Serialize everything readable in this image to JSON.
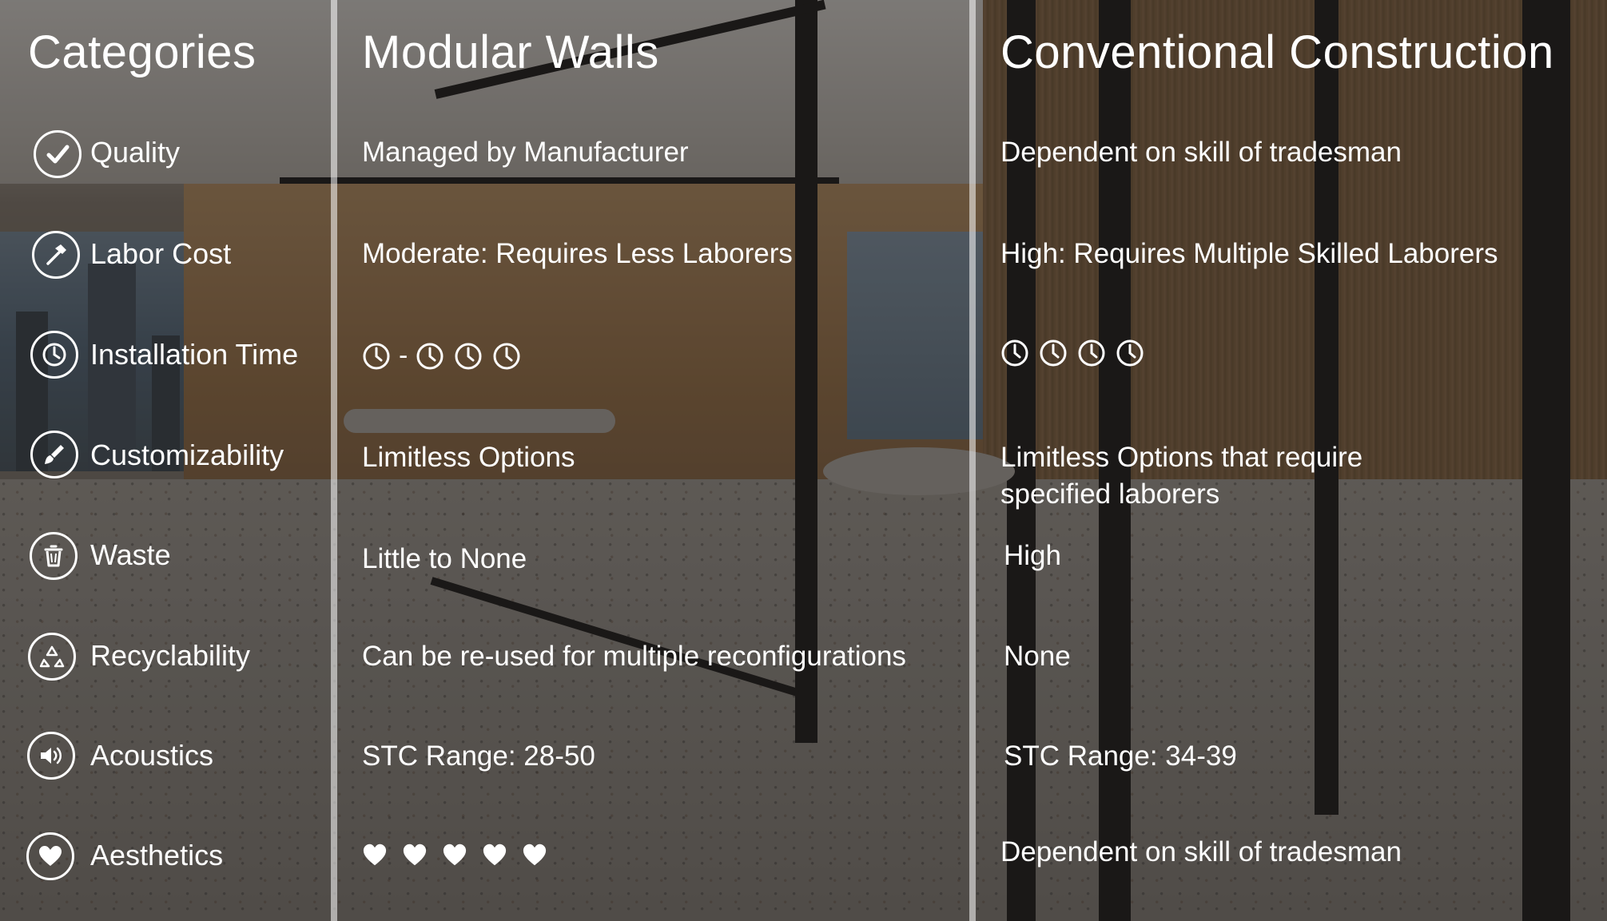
{
  "headers": {
    "categories": "Categories",
    "modular": "Modular Walls",
    "conventional": "Conventional Construction"
  },
  "rows": [
    {
      "icon": "checkmark-icon",
      "label": "Quality",
      "modular": "Managed by Manufacturer",
      "conventional": "Dependent on skill of tradesman"
    },
    {
      "icon": "hammer-icon",
      "label": "Labor Cost",
      "modular": "Moderate: Requires Less Laborers",
      "conventional": "High: Requires Multiple Skilled Laborers"
    },
    {
      "icon": "clock-icon",
      "label": "Installation Time",
      "modular": "1 - 3 clocks",
      "conventional": "4 clocks"
    },
    {
      "icon": "paintbrush-icon",
      "label": "Customizability",
      "modular": "Limitless Options",
      "conventional": "Limitless Options that require specified laborers"
    },
    {
      "icon": "trash-icon",
      "label": "Waste",
      "modular": "Little to None",
      "conventional": "High"
    },
    {
      "icon": "recycle-icon",
      "label": "Recyclability",
      "modular": "Can be re-used for multiple reconfigurations",
      "conventional": "None"
    },
    {
      "icon": "speaker-icon",
      "label": "Acoustics",
      "modular": "STC Range: 28-50",
      "conventional": "STC Range: 34-39"
    },
    {
      "icon": "heart-icon",
      "label": "Aesthetics",
      "modular": "5 hearts",
      "conventional": "Dependent on skill of tradesman"
    }
  ],
  "installation_time": {
    "modular_dash": "-",
    "modular_min_clocks": 1,
    "modular_max_clocks": 3,
    "conventional_clocks": 4
  },
  "aesthetics": {
    "modular_hearts": 5
  },
  "colors": {
    "text": "#ffffff",
    "overlay": "rgba(25,22,20,0.52)",
    "divider": "rgba(255,255,255,0.55)"
  }
}
